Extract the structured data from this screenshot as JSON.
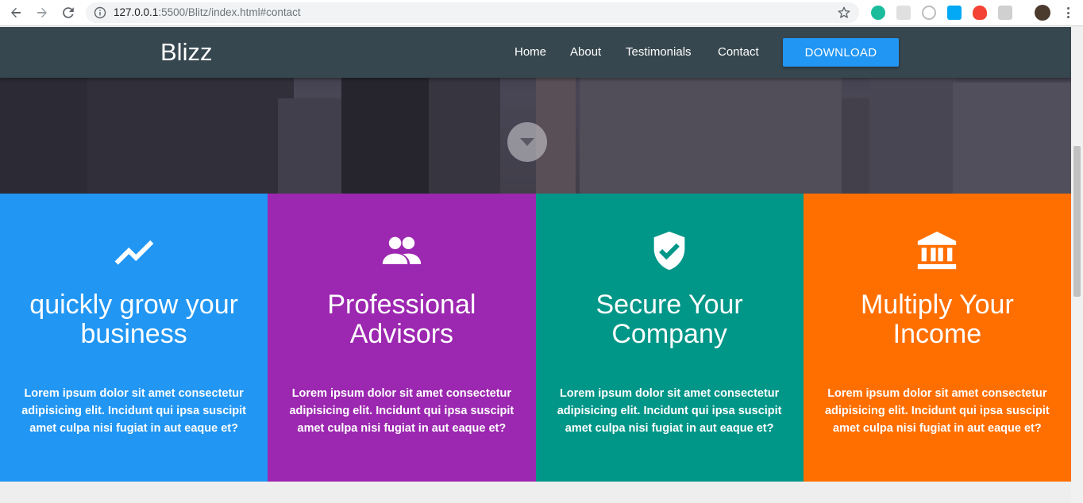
{
  "browser": {
    "url_host": "127.0.0.1",
    "url_rest": ":5500/Blitz/index.html#contact"
  },
  "navbar": {
    "brand": "Blizz",
    "links": [
      "Home",
      "About",
      "Testimonials",
      "Contact"
    ],
    "download_label": "DOWNLOAD"
  },
  "features": [
    {
      "icon": "trending-up-icon",
      "title": "quickly grow your business",
      "text": "Lorem ipsum dolor sit amet consectetur adipisicing elit. Incidunt qui ipsa suscipit amet culpa nisi fugiat in aut eaque et?",
      "color": "#2196f3"
    },
    {
      "icon": "people-icon",
      "title": "Professional Advisors",
      "text": "Lorem ipsum dolor sit amet consectetur adipisicing elit. Incidunt qui ipsa suscipit amet culpa nisi fugiat in aut eaque et?",
      "color": "#9c27b0"
    },
    {
      "icon": "verified-shield-icon",
      "title": "Secure Your Company",
      "text": "Lorem ipsum dolor sit amet consectetur adipisicing elit. Incidunt qui ipsa suscipit amet culpa nisi fugiat in aut eaque et?",
      "color": "#009688"
    },
    {
      "icon": "bank-icon",
      "title": "Multiply Your Income",
      "text": "Lorem ipsum dolor sit amet consectetur adipisicing elit. Incidunt qui ipsa suscipit amet culpa nisi fugiat in aut eaque et?",
      "color": "#ff6f00"
    }
  ],
  "colors": {
    "navbar": "#37474f",
    "accent": "#2196f3"
  }
}
